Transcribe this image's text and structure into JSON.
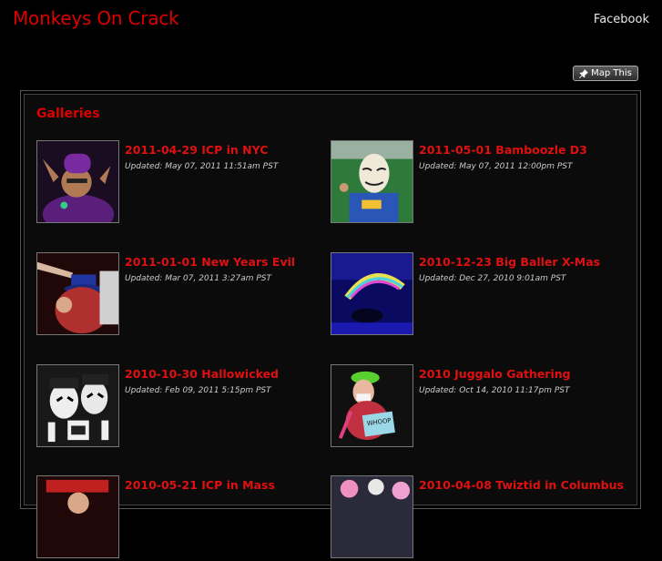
{
  "header": {
    "site_title": "Monkeys On Crack",
    "facebook_link": "Facebook"
  },
  "toolbar": {
    "map_button_label": "Map This",
    "map_button_icon": "pin-icon"
  },
  "main": {
    "section_title": "Galleries",
    "galleries": [
      {
        "title": "2011-04-29 ICP in NYC",
        "updated": "Updated: May 07, 2011 11:51am PST"
      },
      {
        "title": "2011-05-01 Bamboozle D3",
        "updated": "Updated: May 07, 2011 12:00pm PST"
      },
      {
        "title": "2011-01-01 New Years Evil",
        "updated": "Updated: Mar 07, 2011 3:27am PST"
      },
      {
        "title": "2010-12-23 Big Baller X-Mas",
        "updated": "Updated: Dec 27, 2010 9:01am PST"
      },
      {
        "title": "2010-10-30 Hallowicked",
        "updated": "Updated: Feb 09, 2011 5:15pm PST"
      },
      {
        "title": "2010 Juggalo Gathering",
        "updated": "Updated: Oct 14, 2010 11:17pm PST"
      },
      {
        "title": "2010-05-21 ICP in Mass",
        "updated": ""
      },
      {
        "title": "2010-04-08 Twiztid in Columbus",
        "updated": ""
      }
    ]
  },
  "colors": {
    "accent": "#dd0000",
    "background": "#000000"
  }
}
